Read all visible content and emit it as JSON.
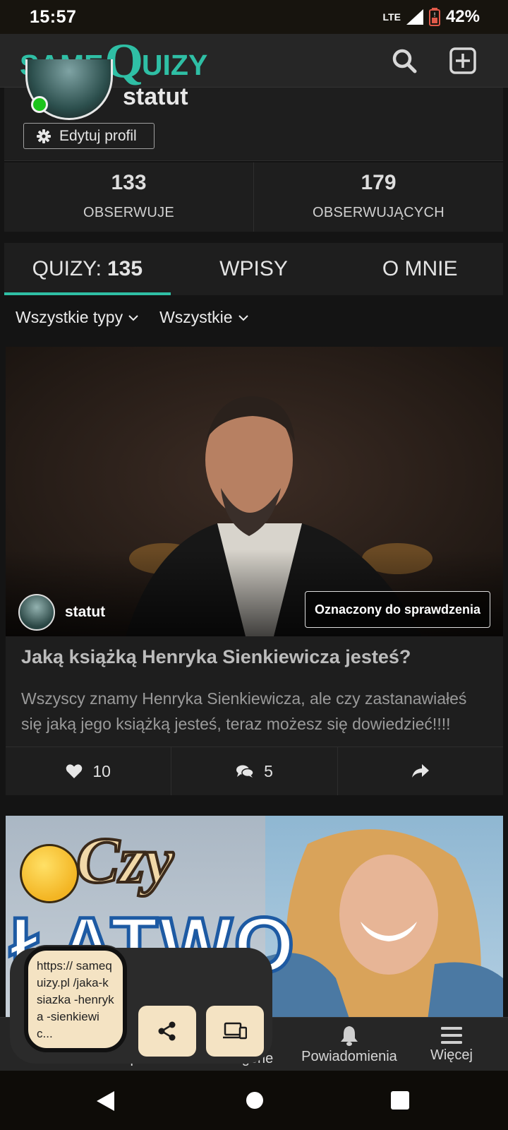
{
  "status_bar": {
    "time": "15:57",
    "network": "LTE",
    "battery": "42%"
  },
  "header": {
    "logo_part1": "SAME",
    "logo_q": "Q",
    "logo_part2": "UIZY"
  },
  "profile": {
    "username": "statut",
    "edit_label": "Edytuj profil"
  },
  "stats": [
    {
      "value": "133",
      "label": "OBSERWUJE"
    },
    {
      "value": "179",
      "label": "OBSERWUJĄCYCH"
    }
  ],
  "tabs": {
    "quizzes_label": "QUIZY:",
    "quizzes_count": "135",
    "posts": "WPISY",
    "about": "O MNIE"
  },
  "filters": {
    "type": "Wszystkie typy",
    "scope": "Wszystkie"
  },
  "quiz": {
    "author": "statut",
    "badge": "Oznaczony do sprawdzenia",
    "title": "Jaką książką Henryka Sienkiewicza jesteś?",
    "description": "Wszyscy znamy Henryka Sienkiewicza, ale czy zastanawiałeś się jaką jego książką jesteś, teraz możesz się dowiedzieć!!!!",
    "likes": "10",
    "comments": "5"
  },
  "quiz2": {
    "image_text_1": "Czy",
    "image_text_2": "ŁATWO"
  },
  "bottom_nav": {
    "partial_left": "p",
    "partial_mid": "gorie",
    "notifications": "Powiadomienia",
    "more": "Więcej"
  },
  "share_popup": {
    "url": "https:// samequizy.pl /jaka-ksiazka -henryka -sienkiewic..."
  },
  "colors": {
    "accent": "#2fbfa5",
    "background": "#141414",
    "card": "#1e1e1e",
    "popup": "#f4e3c3"
  }
}
